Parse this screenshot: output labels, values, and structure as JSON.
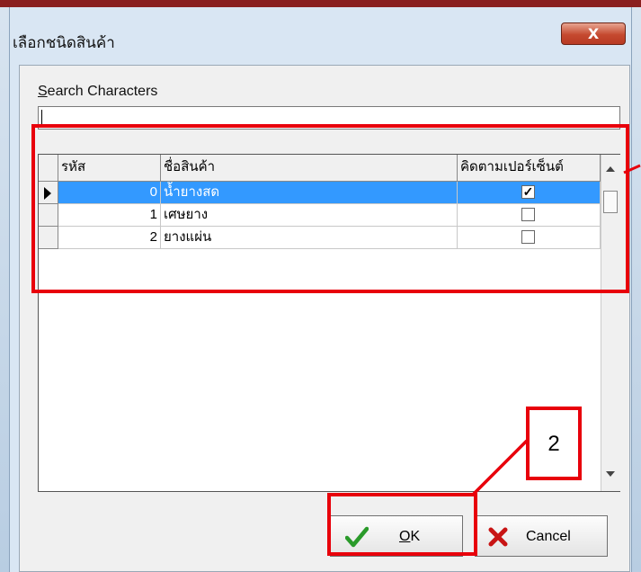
{
  "window": {
    "title": "เลือกชนิดสินค้า",
    "close_glyph": "X"
  },
  "search": {
    "label_mnemonic": "S",
    "label_rest": "earch Characters",
    "value": ""
  },
  "grid": {
    "columns": [
      "รหัส",
      "ชื่อสินค้า",
      "คิดตามเปอร์เซ็นต์"
    ],
    "rows": [
      {
        "code": "0",
        "name": "น้ำยางสด",
        "checked_glyph": "✓",
        "selected": true
      },
      {
        "code": "1",
        "name": "เศษยาง",
        "checked_glyph": "",
        "selected": false
      },
      {
        "code": "2",
        "name": "ยางแผ่น",
        "checked_glyph": "",
        "selected": false
      }
    ]
  },
  "buttons": {
    "ok_mnemonic": "O",
    "ok_rest": "K",
    "cancel": "Cancel"
  },
  "annotation": {
    "callout_number": "2"
  },
  "colors": {
    "selection": "#3399ff",
    "annotation_red": "#e8000b",
    "ok_check": "#2a9a2a",
    "cancel_x": "#c81414"
  },
  "icons": [
    "check-mark-icon",
    "cancel-x-icon",
    "row-pointer-icon",
    "scroll-up-icon",
    "scroll-down-icon",
    "close-icon"
  ]
}
